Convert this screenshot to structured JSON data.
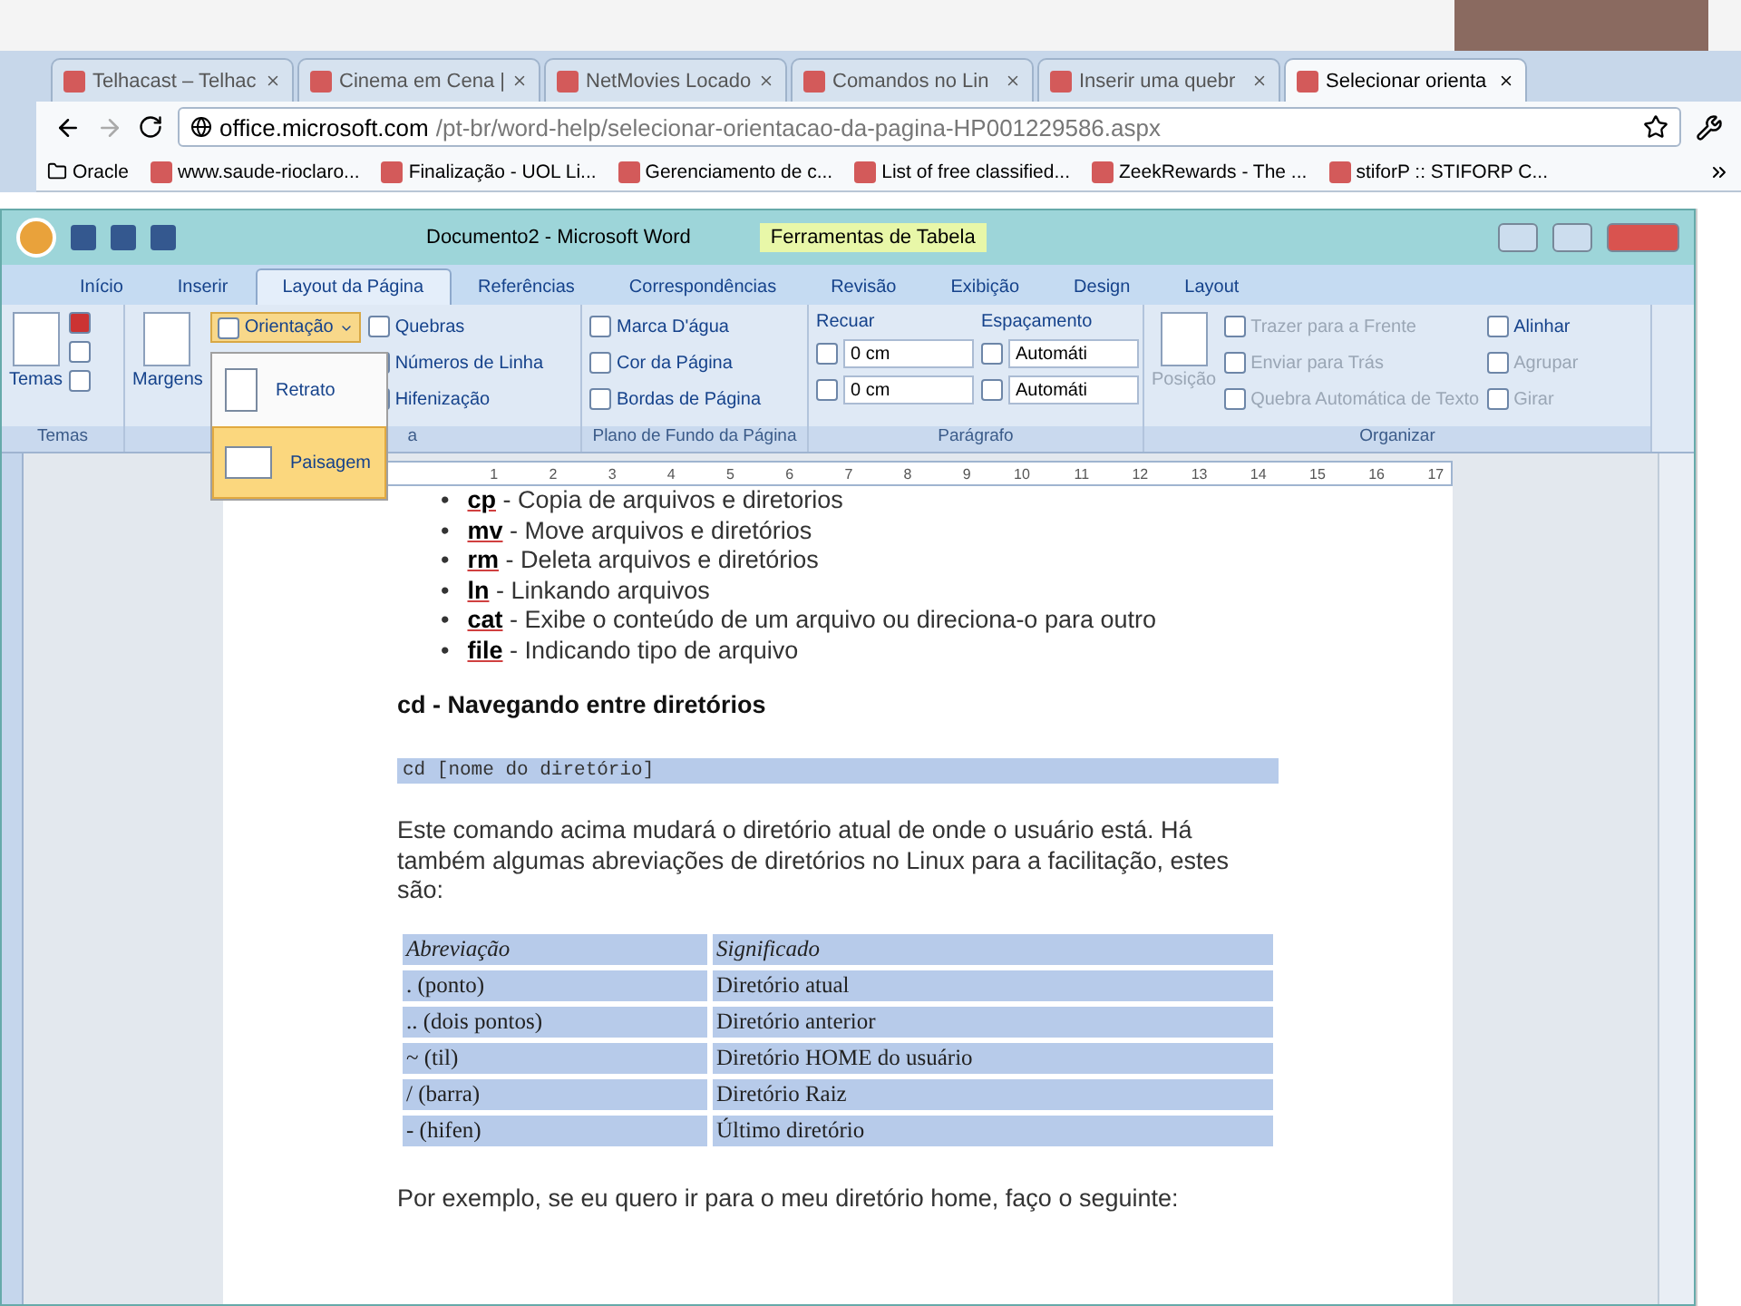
{
  "browser": {
    "tabs": [
      {
        "label": "Telhacast – Telhac",
        "selected": false
      },
      {
        "label": "Cinema em Cena |",
        "selected": false
      },
      {
        "label": "NetMovies Locado",
        "selected": false
      },
      {
        "label": "Comandos no Lin",
        "selected": false
      },
      {
        "label": "Inserir uma quebr",
        "selected": false
      },
      {
        "label": "Selecionar orienta",
        "selected": true
      }
    ],
    "address": {
      "host": "office.microsoft.com",
      "path": "/pt-br/word-help/selecionar-orientacao-da-pagina-HP001229586.aspx"
    },
    "bookmarks": [
      "Oracle",
      "www.saude-rioclaro...",
      "Finalização - UOL Li...",
      "Gerenciamento de c...",
      "List of free classified...",
      "ZeekRewards - The ...",
      "stiforP :: STIFORP C..."
    ]
  },
  "word": {
    "title": "Documento2 - Microsoft Word",
    "context_group": "Ferramentas de Tabela",
    "tabs": [
      {
        "label": "Início",
        "selected": false
      },
      {
        "label": "Inserir",
        "selected": false
      },
      {
        "label": "Layout da Página",
        "selected": true
      },
      {
        "label": "Referências",
        "selected": false
      },
      {
        "label": "Correspondências",
        "selected": false
      },
      {
        "label": "Revisão",
        "selected": false
      },
      {
        "label": "Exibição",
        "selected": false
      },
      {
        "label": "Design",
        "selected": false
      },
      {
        "label": "Layout",
        "selected": false
      }
    ],
    "ribbon": {
      "themes": {
        "button": "Temas",
        "group": "Temas"
      },
      "page_setup": {
        "margins": "Margens",
        "orientation": "Orientação",
        "items": [
          "Quebras",
          "Números de Linha",
          "Hifenização"
        ],
        "group": "a"
      },
      "background": {
        "items": [
          "Marca D'água",
          "Cor da Página",
          "Bordas de Página"
        ],
        "group": "Plano de Fundo da Página"
      },
      "paragraph": {
        "indent_label": "Recuar",
        "spacing_label": "Espaçamento",
        "indent": [
          "0 cm",
          "0 cm"
        ],
        "spacing": [
          "Automáti",
          "Automáti"
        ],
        "group": "Parágrafo"
      },
      "arrange": {
        "position": "Posição",
        "items": [
          {
            "label": "Trazer para a Frente",
            "disabled": true
          },
          {
            "label": "Enviar para Trás",
            "disabled": true
          },
          {
            "label": "Quebra Automática de Texto",
            "disabled": true
          }
        ],
        "side_items": [
          {
            "label": "Alinhar",
            "disabled": false
          },
          {
            "label": "Agrupar",
            "disabled": true
          },
          {
            "label": "Girar",
            "disabled": true
          }
        ],
        "group": "Organizar"
      }
    },
    "orientation_menu": [
      {
        "label": "Retrato",
        "selected": false
      },
      {
        "label": "Paisagem",
        "selected": true
      }
    ],
    "ruler": [
      "1",
      "2",
      "3",
      "4",
      "5",
      "6",
      "7",
      "8",
      "9",
      "10",
      "11",
      "12",
      "13",
      "14",
      "15",
      "16",
      "17"
    ],
    "document": {
      "bullet": "•",
      "commands": [
        {
          "command": "cp",
          "description": "- Copia de arquivos e diretorios"
        },
        {
          "command": "mv",
          "description": "- Move arquivos e diretórios"
        },
        {
          "command": "rm",
          "description": "- Deleta arquivos e diretórios"
        },
        {
          "command": "ln",
          "description": "- Linkando arquivos"
        },
        {
          "command": "cat",
          "description": "- Exibe o conteúdo de um arquivo ou direciona-o para outro"
        },
        {
          "command": "file",
          "description": "- Indicando tipo de arquivo"
        }
      ],
      "heading": "cd - Navegando entre diretórios",
      "code": "cd [nome do diretório]",
      "paragraph": "Este comando acima mudará o diretório atual de onde o usuário está. Há também algumas abreviações de diretórios no Linux para a facilitação, estes são:",
      "table": {
        "header": [
          "Abreviação",
          "Significado"
        ],
        "rows": [
          [
            ". (ponto)",
            "Diretório atual"
          ],
          [
            ".. (dois pontos)",
            "Diretório anterior"
          ],
          [
            "~ (til)",
            "Diretório HOME do usuário"
          ],
          [
            "/ (barra)",
            "Diretório Raiz"
          ],
          [
            "- (hifen)",
            "Último diretório"
          ]
        ]
      },
      "closing": "Por exemplo, se eu quero ir para o meu diretório home, faço o seguinte:"
    }
  }
}
